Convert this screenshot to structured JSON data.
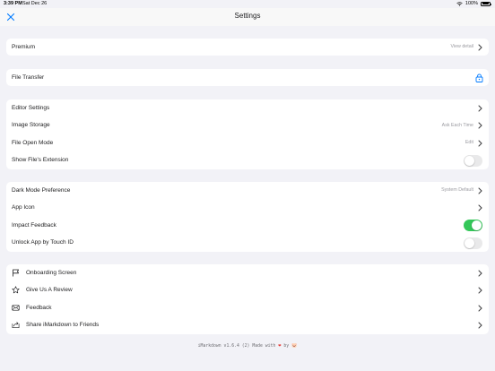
{
  "status_bar": {
    "time": "3:39 PM",
    "date": "Sat Dec 26",
    "battery": "100%"
  },
  "nav": {
    "title": "Settings",
    "close_icon": "close-x-icon"
  },
  "groups": {
    "premium": {
      "label": "Premium",
      "detail": "View detail"
    },
    "file_transfer": {
      "label": "File Transfer",
      "icon": "lock-icon"
    },
    "editor": {
      "editor_settings": {
        "label": "Editor Settings"
      },
      "image_storage": {
        "label": "Image Storage",
        "detail": "Ask Each Time"
      },
      "file_open_mode": {
        "label": "File Open Mode",
        "detail": "Edit"
      },
      "show_extension": {
        "label": "Show File's Extension",
        "toggle": false
      }
    },
    "app": {
      "dark_mode": {
        "label": "Dark Mode Preference",
        "detail": "System Default"
      },
      "app_icon": {
        "label": "App Icon"
      },
      "impact_feedback": {
        "label": "Impact Feedback",
        "toggle": true
      },
      "touch_id": {
        "label": "Unlock App by Touch ID",
        "toggle": false
      }
    },
    "misc": {
      "onboarding": {
        "label": "Onboarding Screen",
        "icon": "flag-icon"
      },
      "review": {
        "label": "Give Us A Review",
        "icon": "star-icon"
      },
      "feedback": {
        "label": "Feedback",
        "icon": "envelope-icon"
      },
      "share": {
        "label": "Share iMarkdown to Friends",
        "icon": "share-icon"
      }
    }
  },
  "footer": {
    "text_before": "iMarkdown v1.6.4 (2) Made with",
    "text_by": "by"
  },
  "colors": {
    "background": "#f2f2f7",
    "accent": "#007aff",
    "toggle_on": "#34c759",
    "toggle_off": "#e9e9ea"
  }
}
